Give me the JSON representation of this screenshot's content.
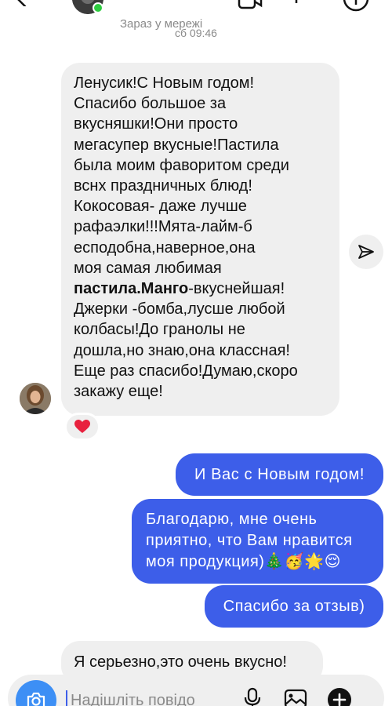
{
  "header": {
    "status": "Зараз у мережі"
  },
  "timestamp": "сб 09:46",
  "messages": {
    "incoming_1_part1": "Ленусик!С Новым годом!\nСпасибо большое за\nвкусняшки!Они просто\nмегасупер вкусные!Пастила\nбыла моим фаворитом среди\nвснх праздничных блюд!\nКокосовая- даже лучше\nрафаэлки!!!Мята-лайм-б\nесподобна,наверное,она\nмоя самая любимая\n",
    "incoming_1_bold": "пастила.Манго",
    "incoming_1_part2": "-вкуснейшая!\nДжерки -бомба,лусше любой\nколбасы!До гранолы не\nдошла,но знаю,она классная!\nЕще раз спасибо!Думаю,скоро\nзакажу еще!",
    "reaction": "❤️",
    "outgoing_1": "И Вас с Новым годом!",
    "outgoing_2": "Благодарю, мне очень приятно, что Вам нравится моя продукция)🎄🥳🌟😌",
    "outgoing_3": "Спасибо за отзыв)",
    "incoming_2": "Я серьезно,это очень вкусно!"
  },
  "composer": {
    "placeholder": "Надішліть повідо"
  },
  "icons": {
    "back": "back-arrow-icon",
    "video": "video-call-icon",
    "info": "info-icon",
    "share": "share-send-icon",
    "camera": "camera-icon",
    "mic": "microphone-icon",
    "gallery": "gallery-icon",
    "add": "add-icon"
  },
  "colors": {
    "outgoing_bubble": "#3d5ee9",
    "incoming_bubble": "#efefef",
    "camera_button": "#3d8ff5",
    "online": "#2ecc40"
  }
}
